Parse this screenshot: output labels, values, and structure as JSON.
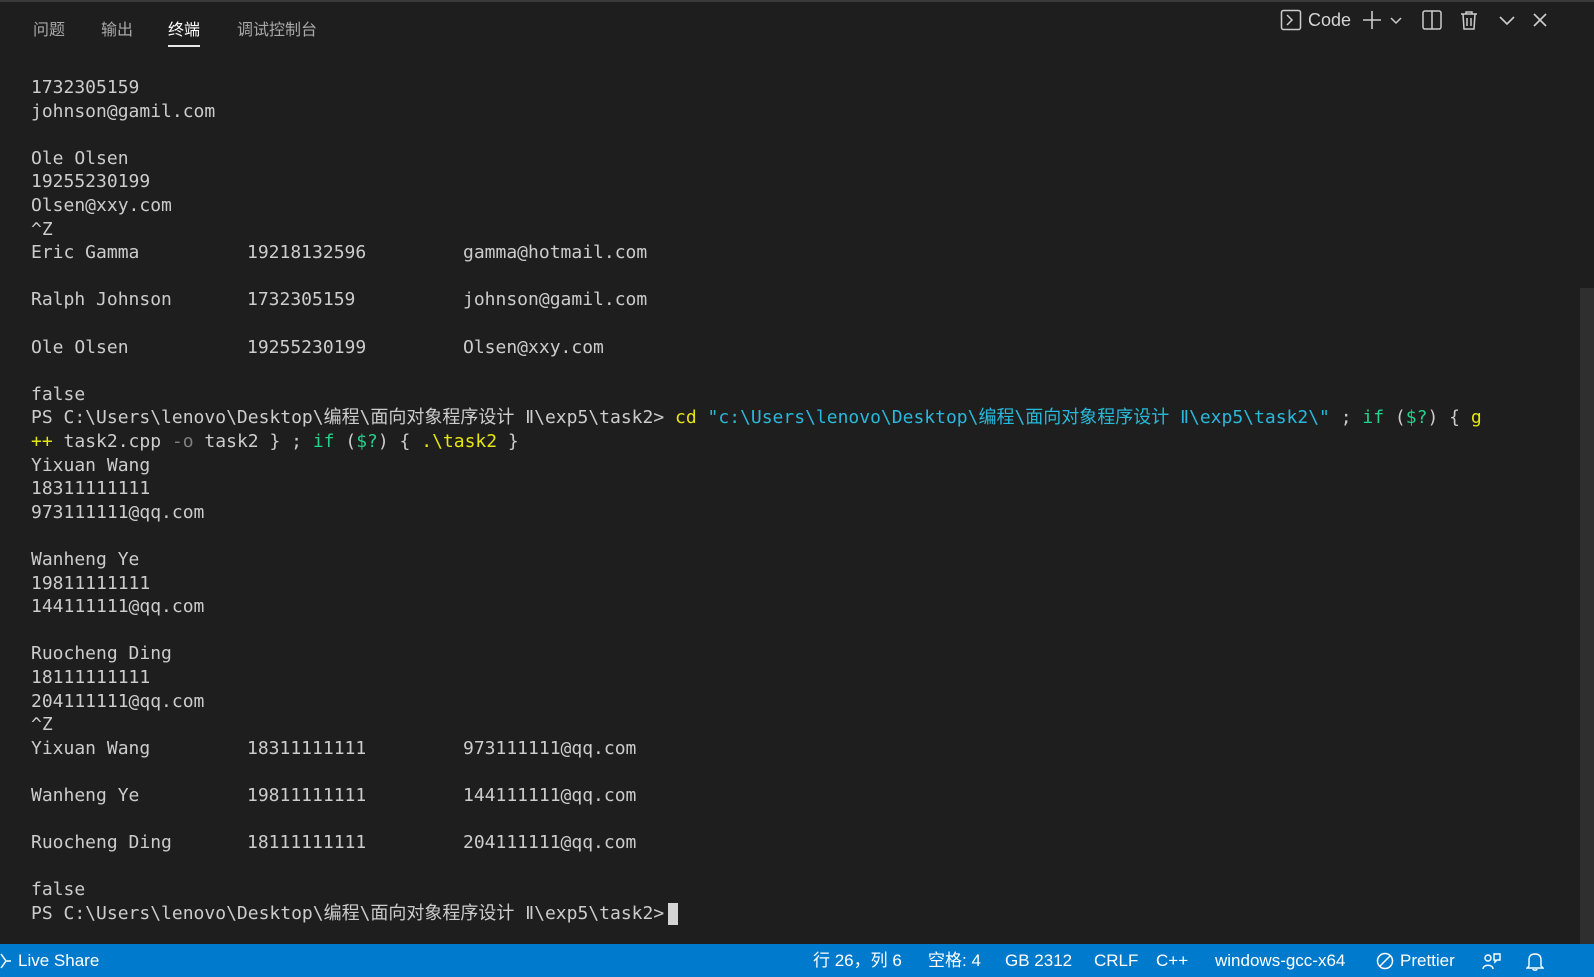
{
  "tabs": [
    "问题",
    "输出",
    "终端",
    "调试控制台"
  ],
  "active_tab": 2,
  "actions": {
    "terminal_profile_label": "Code"
  },
  "terminal": {
    "lines": [
      "1732305159",
      "johnson@gamil.com",
      "",
      "Ole Olsen",
      "19255230199",
      "Olsen@xxy.com",
      "^Z",
      [
        "Eric Gamma",
        "19218132596",
        "gamma@hotmail.com"
      ],
      "",
      [
        "Ralph Johnson",
        "1732305159",
        "johnson@gamil.com"
      ],
      "",
      [
        "Ole Olsen",
        "19255230199",
        "Olsen@xxy.com"
      ],
      "",
      "false"
    ],
    "prompt1": {
      "prompt": "PS C:\\Users\\lenovo\\Desktop\\编程\\面向对象程序设计 Ⅱ\\exp5\\task2> ",
      "cmd": "cd",
      "path": " \"c:\\Users\\lenovo\\Desktop\\编程\\面向对象程序设计 Ⅱ\\exp5\\task2\\\"",
      "sep1": " ; ",
      "if1": "if",
      "cond1_open": " (",
      "cond1": "$?",
      "cond1_close": ") { ",
      "compiler1": "g",
      "compiler2": "++",
      "args1": " task2.cpp ",
      "flag": "-o",
      "args2": " task2 } ; ",
      "if2": "if",
      "cond2_open": " (",
      "cond2": "$?",
      "cond2_close": ") { ",
      "run": ".\\task2",
      "end": " }"
    },
    "lines2": [
      "Yixuan Wang",
      "18311111111",
      "973111111@qq.com",
      "",
      "Wanheng Ye",
      "19811111111",
      "144111111@qq.com",
      "",
      "Ruocheng Ding",
      "18111111111",
      "204111111@qq.com",
      "^Z",
      [
        "Yixuan Wang",
        "18311111111",
        "973111111@qq.com"
      ],
      "",
      [
        "Wanheng Ye",
        "19811111111",
        "144111111@qq.com"
      ],
      "",
      [
        "Ruocheng Ding",
        "18111111111",
        "204111111@qq.com"
      ],
      "",
      "false"
    ],
    "final_prompt": "PS C:\\Users\\lenovo\\Desktop\\编程\\面向对象程序设计 Ⅱ\\exp5\\task2>"
  },
  "status": {
    "live_share": "Live Share",
    "position": "行 26，列 6",
    "spaces": "空格: 4",
    "encoding": "GB 2312",
    "eol": "CRLF",
    "language": "C++",
    "config": "windows-gcc-x64",
    "prettier": "Prettier"
  },
  "icons": [
    "terminal-icon",
    "plus-icon",
    "chevron-down-icon",
    "split-icon",
    "trash-icon",
    "chevron-down-icon",
    "close-icon",
    "live-share-icon",
    "prettier-icon",
    "feedback-icon",
    "bell-icon"
  ],
  "colors": {
    "background": "#1e1e1e",
    "status_bar": "#007acc",
    "command_yellow": "#e5e510",
    "string_cyan": "#29b8db",
    "operator_green": "#23d18b",
    "flag_gray": "#808080"
  }
}
